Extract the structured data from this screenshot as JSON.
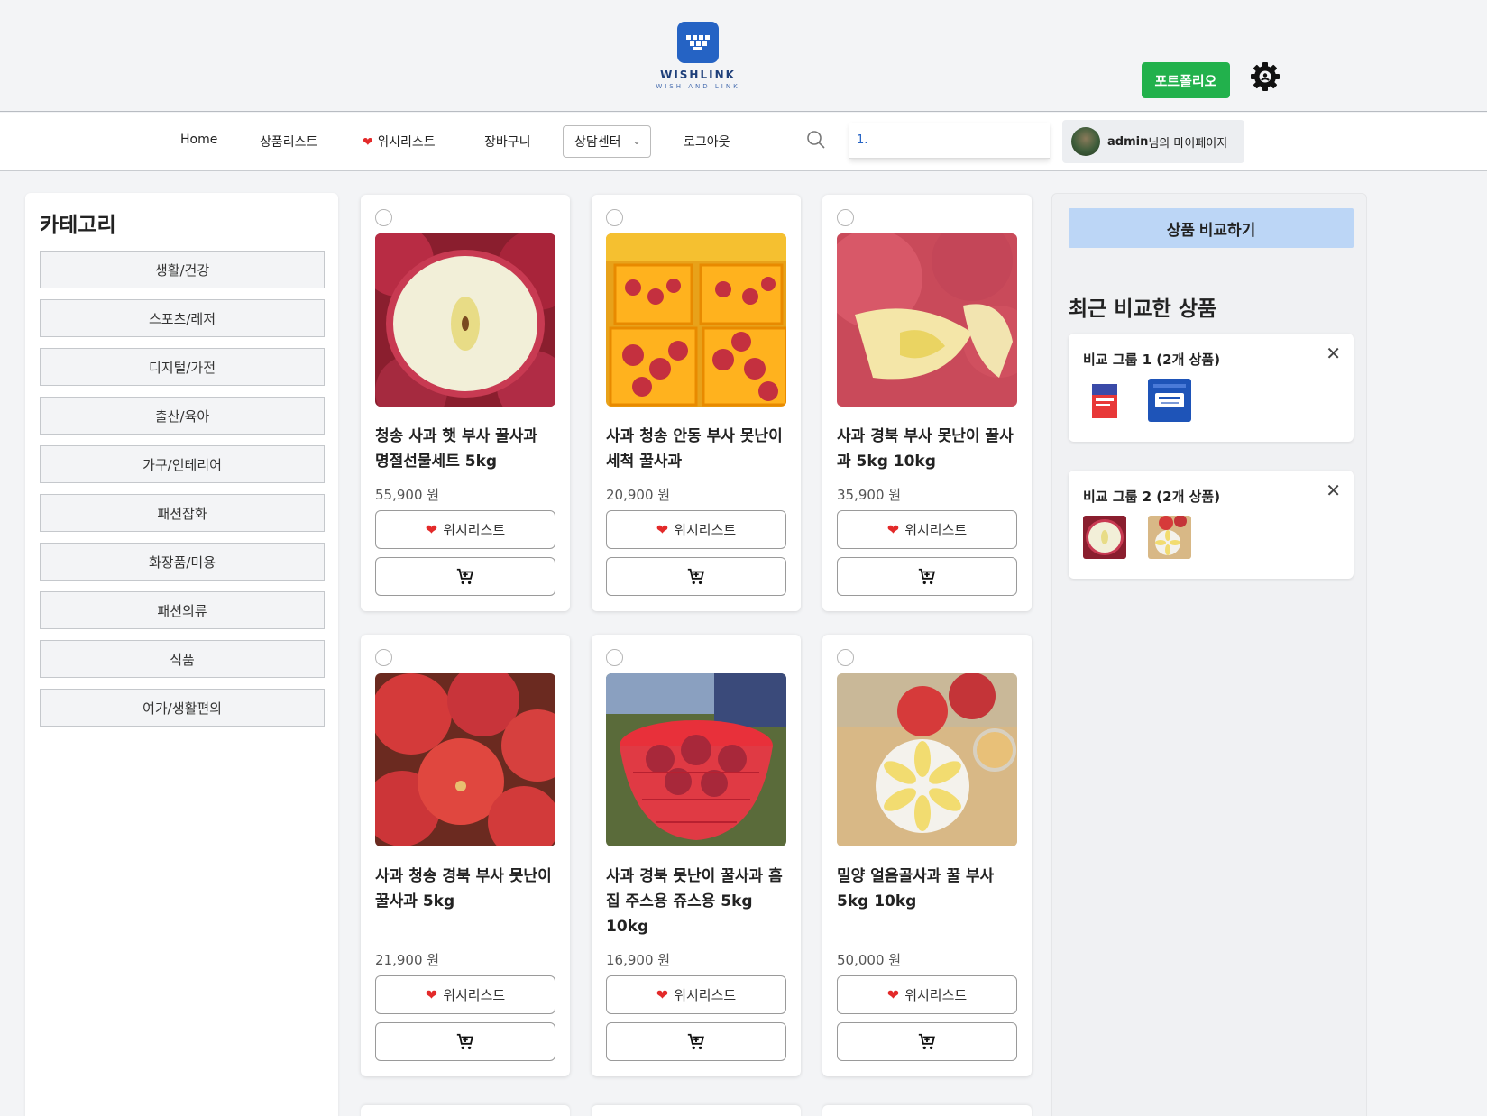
{
  "brand": {
    "name": "WISHLINK",
    "tagline": "WISH AND LINK"
  },
  "header": {
    "portfolio_label": "포트폴리오"
  },
  "nav": {
    "home": "Home",
    "products": "상품리스트",
    "wishlist": "위시리스트",
    "cart": "장바구니",
    "support": "상담센터",
    "logout": "로그아웃",
    "search_value": "1.",
    "mypage_user": "admin",
    "mypage_suffix": "님의 마이페이지"
  },
  "sidebar": {
    "title": "카테고리",
    "categories": [
      "생활/건강",
      "스포츠/레저",
      "디지털/가전",
      "출산/육아",
      "가구/인테리어",
      "패션잡화",
      "화장품/미용",
      "패션의류",
      "식품",
      "여가/생활편의"
    ]
  },
  "products": [
    {
      "name": "청송 사과 햇 부사 꿀사과 명절선물세트 5kg",
      "price": "55,900 원",
      "wish_label": "위시리스트"
    },
    {
      "name": "사과 청송 안동 부사 못난이 세척 꿀사과",
      "price": "20,900 원",
      "wish_label": "위시리스트"
    },
    {
      "name": "사과 경북 부사 못난이 꿀사과 5kg 10kg",
      "price": "35,900 원",
      "wish_label": "위시리스트"
    },
    {
      "name": "사과 청송 경북 부사 못난이 꿀사과 5kg",
      "price": "21,900 원",
      "wish_label": "위시리스트"
    },
    {
      "name": "사과 경북 못난이 꿀사과 흠집 주스용 쥬스용 5kg 10kg",
      "price": "16,900 원",
      "wish_label": "위시리스트"
    },
    {
      "name": "밀양 얼음골사과 꿀 부사 5kg 10kg",
      "price": "50,000 원",
      "wish_label": "위시리스트"
    }
  ],
  "compare": {
    "button_label": "상품 비교하기",
    "recent_title": "최근 비교한 상품",
    "groups": [
      {
        "title": "비교 그룹 1 (2개 상품)"
      },
      {
        "title": "비교 그룹 2 (2개 상품)"
      }
    ]
  },
  "colors": {
    "accent_green": "#22b14c",
    "compare_blue": "#bcd6f6",
    "heart_red": "#e32a2a",
    "brand_blue": "#2563c4"
  }
}
